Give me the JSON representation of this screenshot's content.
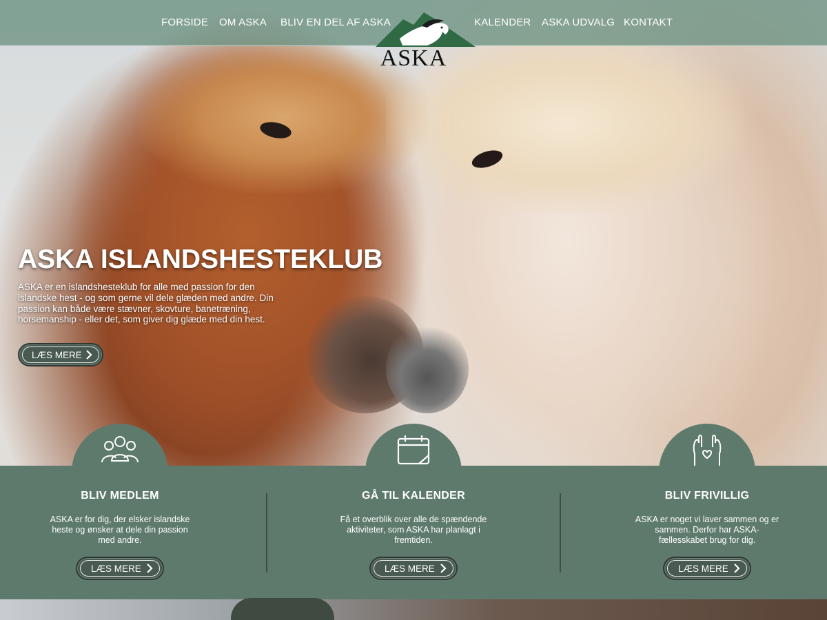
{
  "nav": {
    "left": [
      "FORSIDE",
      "OM ASKA",
      "BLIV EN DEL AF ASKA"
    ],
    "right": [
      "KALENDER",
      "ASKA UDVALG",
      "KONTAKT"
    ],
    "logo_text": "ASKA"
  },
  "hero": {
    "title": "ASKA ISLANDSHESTEKLUB",
    "text": "ASKA er en islandshesteklub for alle med passion for den islandske hest - og som gerne vil dele glæden med andre. Din passion kan både være stævner, skovture, banetræning, horsemanship - eller det, som giver dig glæde med din hest.",
    "button": "LÆS MERE"
  },
  "cards": [
    {
      "icon": "group-icon",
      "title": "BLIV MEDLEM",
      "text": "ASKA er for dig, der elsker islandske heste og ønsker at dele din passion med andre.",
      "button": "LÆS MERE"
    },
    {
      "icon": "calendar-icon",
      "title": "GÅ TIL KALENDER",
      "text": "Få et overblik over alle de spændende aktiviteter, som ASKA har planlagt i fremtiden.",
      "button": "LÆS MERE"
    },
    {
      "icon": "volunteer-hands-icon",
      "title": "BLIV FRIVILLIG",
      "text": "ASKA er noget vi laver sammen og er sammen. Derfor har ASKA-fællesskabet brug for dig.",
      "button": "LÆS MERE"
    }
  ],
  "colors": {
    "band": "#5d7a6c",
    "navbar": "#6c9282",
    "logo_green": "#2f6a45"
  }
}
